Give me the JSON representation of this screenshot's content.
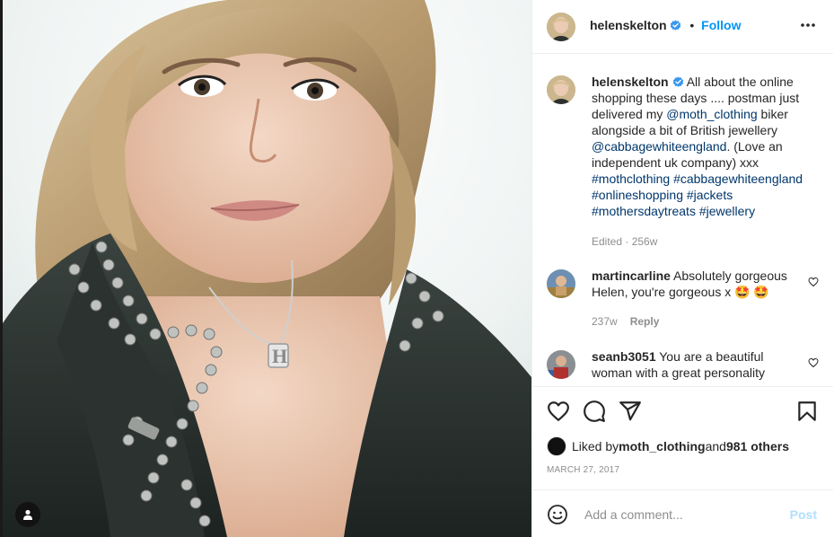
{
  "header": {
    "username": "helenskelton",
    "separator": "•",
    "follow_label": "Follow"
  },
  "caption": {
    "username": "helenskelton",
    "text_1": " All about the online shopping these days .... postman just delivered my ",
    "mention_1": "@moth_clothing",
    "text_2": " biker alongside a bit of British jewellery ",
    "mention_2": "@cabbagewhiteengland",
    "text_3": ". (Love an independent uk company) xxx ",
    "hashtags": [
      "#mothclothing",
      "#cabbagewhiteengland",
      "#onlineshopping",
      "#jackets",
      "#mothersdaytreats",
      "#jewellery"
    ],
    "meta": "Edited · 256w"
  },
  "comments": [
    {
      "username": "martincarline",
      "text": " Absolutely gorgeous Helen, you're gorgeous x 🤩 🤩",
      "age": "237w",
      "reply_label": "Reply"
    },
    {
      "username": "seanb3051",
      "text": " You are a beautiful woman with a great personality"
    }
  ],
  "likes": {
    "prefix": "Liked by ",
    "user": "moth_clothing",
    "middle": " and ",
    "others": "981 others"
  },
  "date": "MARCH 27, 2017",
  "add_comment": {
    "placeholder": "Add a comment...",
    "post_label": "Post"
  },
  "icons": {
    "verified": "verified-badge-icon",
    "more": "more-options-icon",
    "like": "heart-icon",
    "comment": "comment-bubble-icon",
    "share": "paper-plane-icon",
    "save": "bookmark-icon",
    "emoji": "emoji-smiley-icon",
    "user_tag": "user-tag-icon"
  },
  "colors": {
    "accent": "#0095f6",
    "link": "#00376b",
    "muted": "#8e8e8e",
    "post_disabled": "#b2dffc"
  }
}
